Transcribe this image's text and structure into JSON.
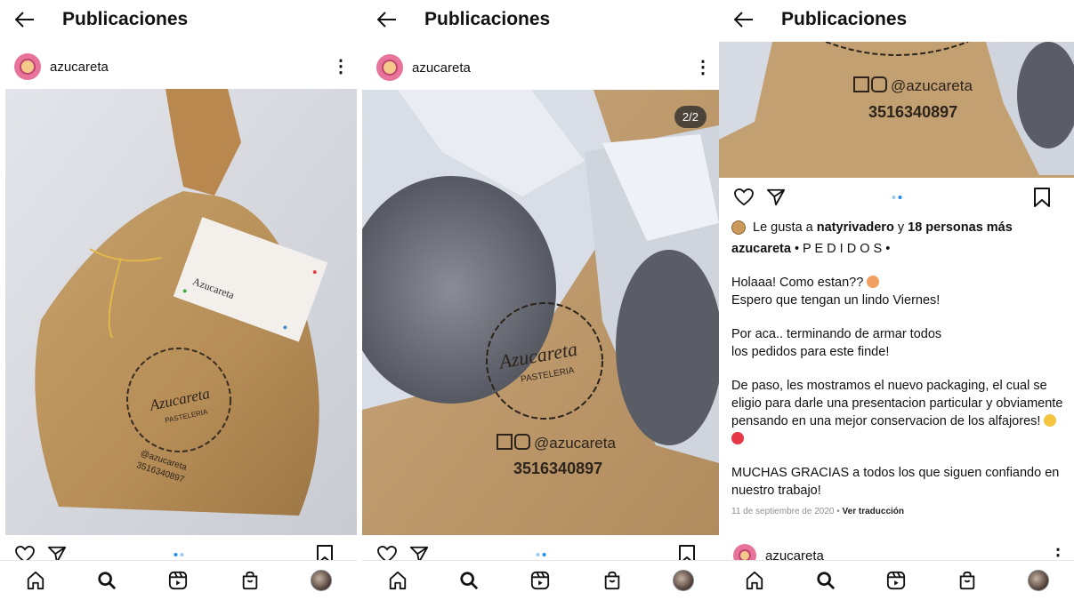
{
  "header": {
    "title": "Publicaciones"
  },
  "post": {
    "username": "azucareta",
    "image_counter": "2/2",
    "stamp": {
      "brand": "Azucareta",
      "subtitle": "PASTELERIA",
      "handle": "@azucareta",
      "phone": "3516340897"
    },
    "tag_text": "Azucareta"
  },
  "likes": {
    "prefix": "Le gusta a",
    "user": "natyrivadero",
    "connector": "y",
    "others": "18 personas más"
  },
  "caption": {
    "username": "azucareta",
    "headline": "• P E D I D O S •",
    "paragraphs": [
      "Holaaa! Como estan??",
      "Espero que tengan un lindo Viernes!",
      "Por aca.. terminando de armar todos",
      "los pedidos para este finde!",
      "De paso, les mostramos el nuevo packaging, el cual se eligio para darle una presentacion particular y obviamente pensando en una mejor conservacion de los alfajores!",
      "MUCHAS GRACIAS a todos los que siguen confiando en nuestro trabajo!"
    ],
    "date": "11 de septiembre de 2020",
    "separator": "•",
    "translate": "Ver traducción"
  },
  "next_post": {
    "username": "azucareta"
  },
  "icons": {
    "back": "arrow-left-icon",
    "more": "more-vertical-icon",
    "like": "heart-icon",
    "share": "send-icon",
    "save": "bookmark-icon",
    "home": "home-icon",
    "search": "search-icon",
    "reels": "reels-icon",
    "shop": "shop-bag-icon",
    "profile": "profile-avatar"
  },
  "colors": {
    "accent_dot": "#1d8fe8",
    "avatar_ring": "#e8739b"
  }
}
